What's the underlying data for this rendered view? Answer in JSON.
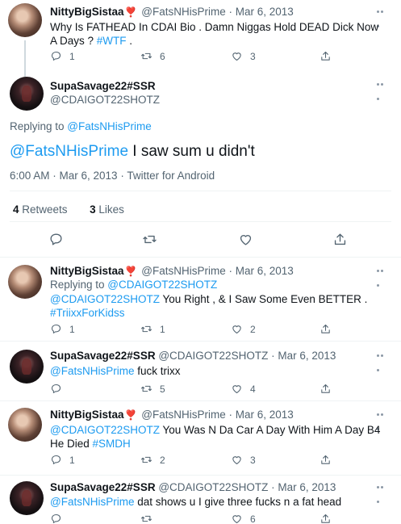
{
  "tweets": [
    {
      "name": "NittyBigSistaa",
      "handle": "@FatsNHisPrime",
      "date": "· Mar 6, 2013",
      "text": "Why Is FATHEAD In CDAI Bio . Damn Niggas Hold DEAD Dick Now A Days ? ",
      "hashtag": "#WTF",
      "text_tail": " .",
      "replies": "1",
      "retweets": "6",
      "likes": "3"
    },
    {
      "name": "NittyBigSistaa",
      "handle": "@FatsNHisPrime",
      "date": "· Mar 6, 2013",
      "replying_prefix": "Replying to ",
      "replying_to": "@CDAIGOT22SHOTZ",
      "mention": "@CDAIGOT22SHOTZ",
      "text": " You Right , & I Saw Some Even BETTER .",
      "hashtag": "#TriixxForKidss",
      "replies": "1",
      "retweets": "1",
      "likes": "2"
    },
    {
      "name": "SupaSavage22#SSR",
      "handle": "@CDAIGOT22SHOTZ",
      "date": "· Mar 6, 2013",
      "mention": "@FatsNHisPrime",
      "text": " fuck trixx",
      "replies": "",
      "retweets": "5",
      "likes": "4"
    },
    {
      "name": "NittyBigSistaa",
      "handle": "@FatsNHisPrime",
      "date": "· Mar 6, 2013",
      "mention": "@CDAIGOT22SHOTZ",
      "text": " You Was N Da Car A Day With Him A Day B4 He Died ",
      "hashtag": "#SMDH",
      "replies": "1",
      "retweets": "2",
      "likes": "3"
    },
    {
      "name": "SupaSavage22#SSR",
      "handle": "@CDAIGOT22SHOTZ",
      "date": "· Mar 6, 2013",
      "mention": "@FatsNHisPrime",
      "text": " dat shows u I give three fucks n a fat head",
      "replies": "",
      "retweets": "",
      "likes": "6"
    }
  ],
  "main": {
    "name": "SupaSavage22#SSR",
    "handle": "@CDAIGOT22SHOTZ",
    "replying_prefix": "Replying to ",
    "replying_to": "@FatsNHisPrime",
    "mention": "@FatsNHisPrime",
    "text": " I saw sum u didn't",
    "timestamp": "6:00 AM · Mar 6, 2013 · Twitter for Android",
    "retweet_count": "4",
    "retweet_label": " Retweets",
    "like_count": "3",
    "like_label": " Likes"
  },
  "icons": {
    "reply": "reply-icon",
    "retweet": "retweet-icon",
    "like": "heart-icon",
    "share": "share-icon",
    "more": "more-icon"
  },
  "colors": {
    "link": "#1d9bf0",
    "secondary_text": "#536471",
    "heart_emoji": "#e0245e"
  }
}
